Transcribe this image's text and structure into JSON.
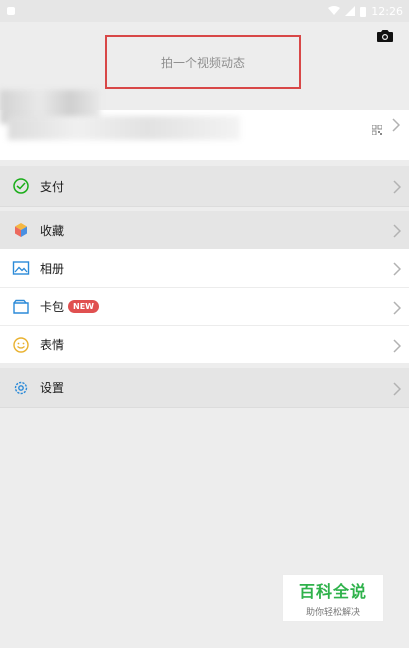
{
  "status_bar": {
    "time": "12:26"
  },
  "header": {
    "video_prompt": "拍一个视频动态"
  },
  "menu": {
    "pay": "支付",
    "favorites": "收藏",
    "album": "相册",
    "cards": "卡包",
    "cards_badge": "NEW",
    "stickers": "表情",
    "settings": "设置"
  },
  "watermark": {
    "title": "百科全说",
    "subtitle": "助你轻松解决"
  },
  "colors": {
    "background": "#ededed",
    "badge": "#e05050",
    "highlight_box": "#d84747",
    "watermark": "#2fb24b"
  }
}
